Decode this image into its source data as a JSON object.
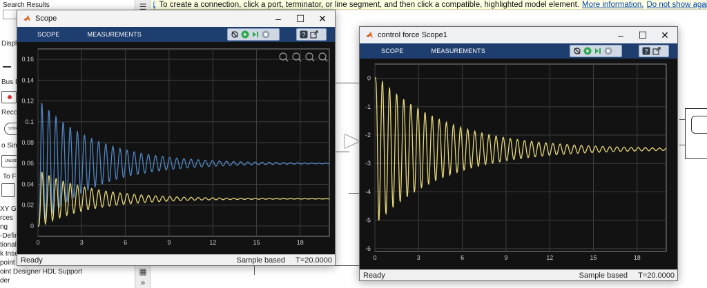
{
  "library": {
    "search_title": "Search Results",
    "labels": [
      "Displ",
      "Bus El",
      "Recor",
      "o Simu",
      "To Fil",
      "XY Gra",
      "rces",
      "ng",
      "-Defin",
      "tional",
      "k Inse",
      "point De",
      "oint Designer HDL Support",
      "der"
    ],
    "blocks": [
      "STOP",
      "UNUSE"
    ]
  },
  "infobar": {
    "message": "To create a connection, click a port, terminator, or line segment, and then click a compatible, highlighted model element.",
    "link_more": "More information.",
    "link_dismiss": "Do not show again"
  },
  "windows": {
    "scope": {
      "title": "Scope",
      "tabs": [
        "SCOPE",
        "MEASUREMENTS"
      ],
      "status_left": "Ready",
      "status_mode": "Sample based",
      "status_time": "T=20.0000",
      "bg": "#f3f3f3"
    },
    "scope1": {
      "title": "control force Scope1",
      "tabs": [
        "SCOPE",
        "MEASUREMENTS"
      ],
      "status_left": "Ready",
      "status_mode": "Sample based",
      "status_time": "T=20.0000",
      "bg": "#eef0f3"
    }
  },
  "toolbar_icons": [
    "pin-icon",
    "run-icon",
    "step-forward-icon",
    "stop-icon",
    "help-icon",
    "undock-icon"
  ],
  "plot_icons": [
    "pan-icon",
    "zoom-in-icon",
    "zoom-out-icon",
    "fit-icon"
  ],
  "colors": {
    "blue_series": "#4f86c6",
    "yellow_series": "#e6d77a",
    "toolstrip": "#1e3e6f",
    "plot_bg": "#121212"
  },
  "chart_data": [
    {
      "type": "line",
      "title": "",
      "xlim": [
        0,
        20
      ],
      "ylim": [
        -0.01,
        0.17
      ],
      "x_ticks": [
        "0",
        "3",
        "6",
        "9",
        "12",
        "15",
        "18"
      ],
      "y_ticks": [
        "0",
        "0.02",
        "0.04",
        "0.06",
        "0.08",
        "0.1",
        "0.12",
        "0.14",
        "0.16"
      ],
      "grid": true,
      "series": [
        {
          "color": "#4f86c6",
          "start": 0,
          "peak": 0.109,
          "final": 0.06,
          "freq_hz": 2.05,
          "decay": 0.26
        },
        {
          "color": "#e6d77a",
          "start": 0,
          "peak": 0.054,
          "final": 0.026,
          "freq_hz": 2.05,
          "decay": 0.28
        }
      ]
    },
    {
      "type": "line",
      "title": "",
      "xlim": [
        0,
        20
      ],
      "ylim": [
        -6.1,
        0.5
      ],
      "x_ticks": [
        "0",
        "3",
        "6",
        "9",
        "12",
        "15",
        "18"
      ],
      "y_ticks": [
        "-6",
        "-5",
        "-4",
        "-3",
        "-2",
        "-1",
        "0"
      ],
      "grid": true,
      "series": [
        {
          "color": "#e6d77a",
          "start": 0,
          "trough": -5.3,
          "final": -2.5,
          "freq_hz": 2.05,
          "decay": 0.21
        }
      ]
    }
  ]
}
